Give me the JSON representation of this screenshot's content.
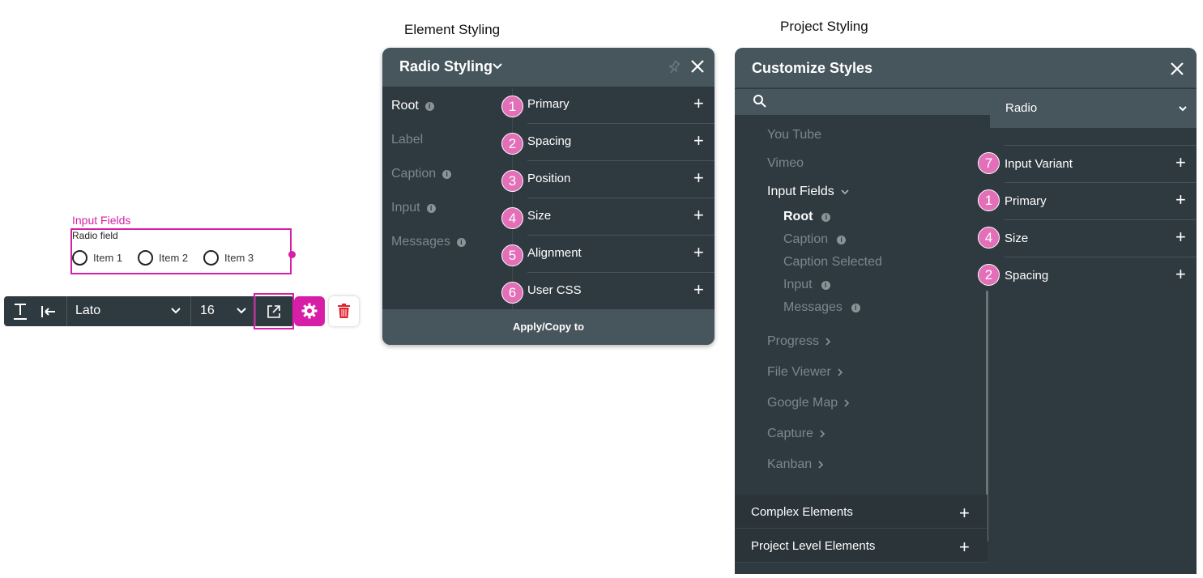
{
  "input_widget": {
    "title": "Input Fields",
    "field_label": "Radio field",
    "options": [
      "Item 1",
      "Item 2",
      "Item 3"
    ]
  },
  "toolbar": {
    "font": "Lato",
    "size": "16"
  },
  "element_styling": {
    "heading": "Element Styling",
    "title": "Radio Styling",
    "left_items": [
      {
        "label": "Root",
        "active": true,
        "info": true
      },
      {
        "label": "Label",
        "active": false,
        "info": false
      },
      {
        "label": "Caption",
        "active": false,
        "info": true
      },
      {
        "label": "Input",
        "active": false,
        "info": true
      },
      {
        "label": "Messages",
        "active": false,
        "info": true
      }
    ],
    "rows": [
      {
        "badge": "1",
        "label": "Primary"
      },
      {
        "badge": "2",
        "label": "Spacing"
      },
      {
        "badge": "3",
        "label": "Position"
      },
      {
        "badge": "4",
        "label": "Size"
      },
      {
        "badge": "5",
        "label": "Alignment"
      },
      {
        "badge": "6",
        "label": "User CSS"
      }
    ],
    "footer": "Apply/Copy to"
  },
  "project_styling": {
    "heading": "Project Styling",
    "title": "Customize Styles",
    "selected": "Radio",
    "tree": {
      "you_tube": "You Tube",
      "vimeo": "Vimeo",
      "input_fields": "Input Fields",
      "root": "Root",
      "caption": "Caption",
      "caption_selected": "Caption Selected",
      "input": "Input",
      "messages": "Messages",
      "progress": "Progress",
      "file_viewer": "File Viewer",
      "google_map": "Google Map",
      "capture": "Capture",
      "kanban": "Kanban"
    },
    "sections": [
      "Complex Elements",
      "Project Level Elements"
    ],
    "rows": [
      {
        "badge": "7",
        "label": "Input Variant"
      },
      {
        "badge": "1",
        "label": "Primary"
      },
      {
        "badge": "4",
        "label": "Size"
      },
      {
        "badge": "2",
        "label": "Spacing"
      }
    ]
  },
  "colors": {
    "accent": "#d61fa6",
    "badge": "#e26fb7",
    "panel": "#2f3a40",
    "panel_header": "#47555c"
  }
}
